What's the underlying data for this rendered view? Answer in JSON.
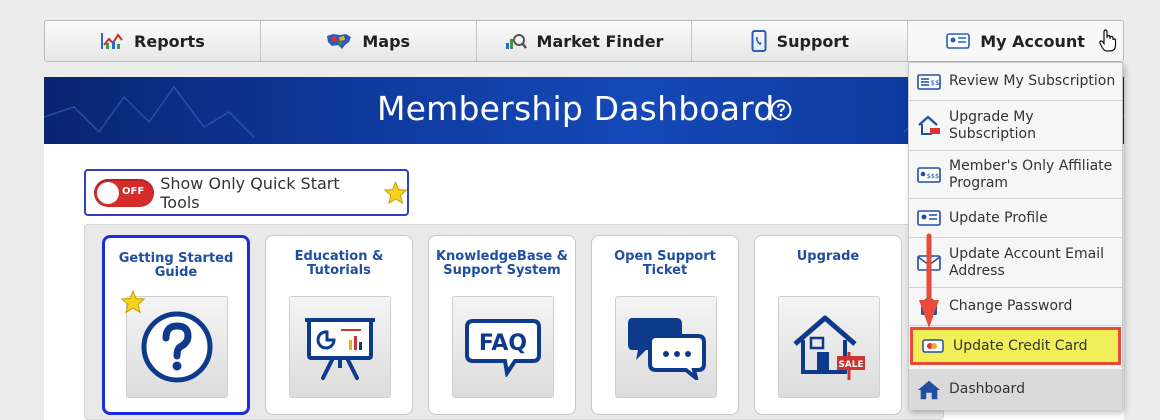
{
  "nav": {
    "items": [
      {
        "label": "Reports",
        "icon": "reports-chart-icon"
      },
      {
        "label": "Maps",
        "icon": "usa-map-icon"
      },
      {
        "label": "Market Finder",
        "icon": "market-finder-icon"
      },
      {
        "label": "Support",
        "icon": "phone-support-icon"
      },
      {
        "label": "My Account",
        "icon": "account-card-icon"
      }
    ]
  },
  "banner": {
    "title": "Membership Dashboard"
  },
  "quick_start": {
    "toggle_state": "OFF",
    "label": "Show Only Quick Start Tools"
  },
  "tiles": [
    {
      "label": "Getting Started Guide",
      "icon": "question-icon"
    },
    {
      "label": "Education & Tutorials",
      "icon": "presentation-board-icon"
    },
    {
      "label": "KnowledgeBase & Support System",
      "icon": "faq-bubble-icon"
    },
    {
      "label": "Open Support Ticket",
      "icon": "chat-bubbles-icon"
    },
    {
      "label": "Upgrade",
      "icon": "house-sale-icon"
    }
  ],
  "dropdown": {
    "items": [
      {
        "label": "Review My Subscription",
        "icon": "subscription-list-icon"
      },
      {
        "label": "Upgrade My Subscription",
        "icon": "upgrade-house-icon"
      },
      {
        "label": "Member's Only Affiliate Program",
        "icon": "affiliate-card-icon"
      },
      {
        "label": "Update Profile",
        "icon": "profile-card-icon"
      },
      {
        "label": "Update Account Email Address",
        "icon": "email-icon"
      },
      {
        "label": "Change Password",
        "icon": "password-icon"
      },
      {
        "label": "Update Credit Card",
        "icon": "credit-card-icon"
      },
      {
        "label": "Dashboard",
        "icon": "home-icon"
      }
    ]
  },
  "colors": {
    "banner": "#0f3a9e",
    "tile_label": "#1f4ea3",
    "highlight": "#f1ef57",
    "highlight_border": "#e84a3c",
    "arrow": "#e84a3c"
  }
}
